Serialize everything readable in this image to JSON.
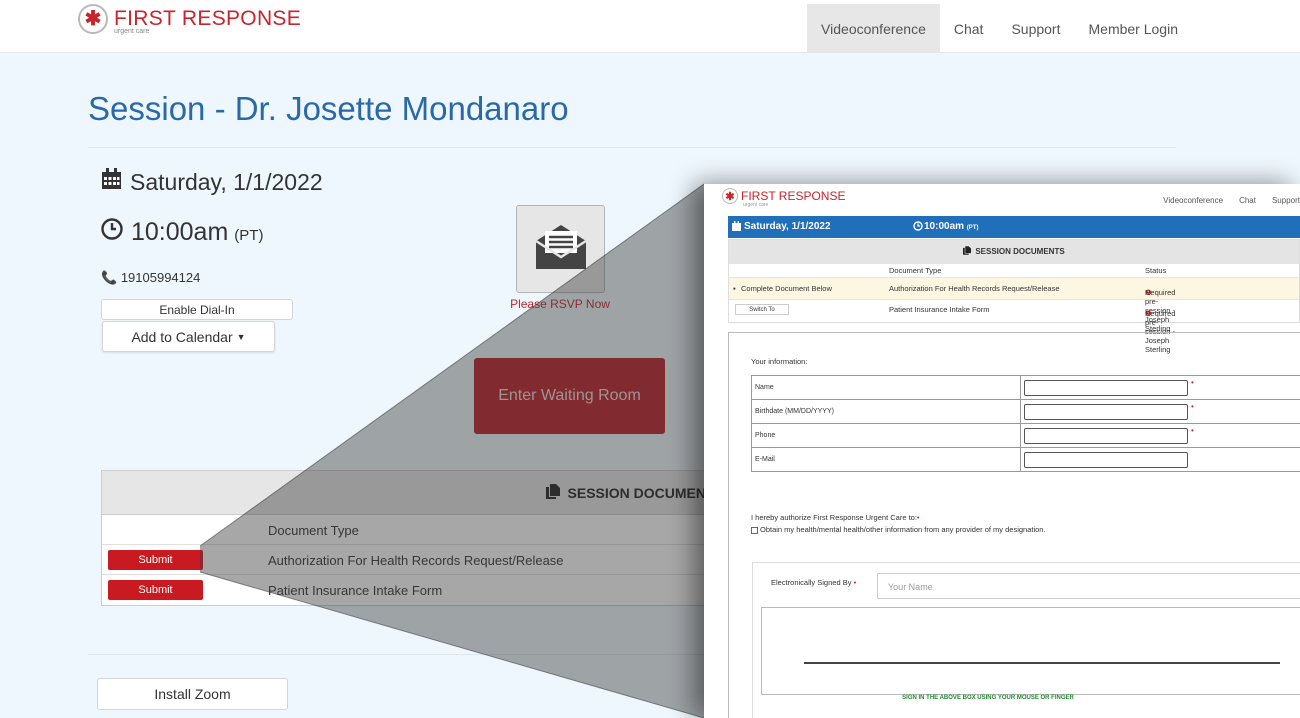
{
  "brand": {
    "name": "FIRST RESPONSE",
    "sub": "urgent care"
  },
  "nav": [
    "Videoconference",
    "Chat",
    "Support",
    "Member Login"
  ],
  "title": "Session - Dr. Josette Mondanaro",
  "date": "Saturday, 1/1/2022",
  "time": "10:00am",
  "tz": "(PT)",
  "phone": "19105994124",
  "buttons": {
    "dial_in": "Enable Dial-In",
    "calendar": "Add to Calendar",
    "rsvp": "Please RSVP Now",
    "waiting_room": "Enter Waiting Room",
    "install_zoom": "Install Zoom"
  },
  "docs": {
    "title": "SESSION DOCUMEN",
    "col_type": "Document Type",
    "rows": [
      {
        "action": "Submit",
        "type": "Authorization For Health Records Request/Release"
      },
      {
        "action": "Submit",
        "type": "Patient Insurance Intake Form"
      }
    ]
  },
  "inset": {
    "brand": "FIRST RESPONSE",
    "brand_sub": "urgent care",
    "nav": [
      "Videoconference",
      "Chat",
      "Support"
    ],
    "date": "Saturday, 1/1/2022",
    "time": "10:00am",
    "tz": "(PT)",
    "docs_title": "SESSION DOCUMENTS",
    "col_type": "Document Type",
    "col_status": "Status",
    "rows": [
      {
        "action": "Complete Document Below",
        "type": "Authorization For Health Records Request/Release",
        "status": "Required pre-session - Joseph Sterling"
      },
      {
        "action": "Switch To",
        "type": "Patient Insurance Intake Form",
        "status": "Required pre-session - Joseph Sterling"
      }
    ],
    "form": {
      "your_info": "Your information:",
      "fields": [
        "Name",
        "Birthdate (MM/DD/YYYY)",
        "Phone",
        "E-Mail"
      ],
      "authorize": "I hereby authorize First Response Urgent Care to:",
      "option": "Obtain my health/mental health/other information from any provider of my designation.",
      "signed_by": "Electronically Signed By",
      "sig_placeholder": "Your Name",
      "sig_hint": "SIGN IN THE ABOVE BOX USING YOUR MOUSE OR FINGER"
    }
  },
  "colors": {
    "brand_red": "#c9232b",
    "title_blue": "#2a69a8",
    "bar_blue": "#1f6fba",
    "button_red": "#bb1c25"
  }
}
